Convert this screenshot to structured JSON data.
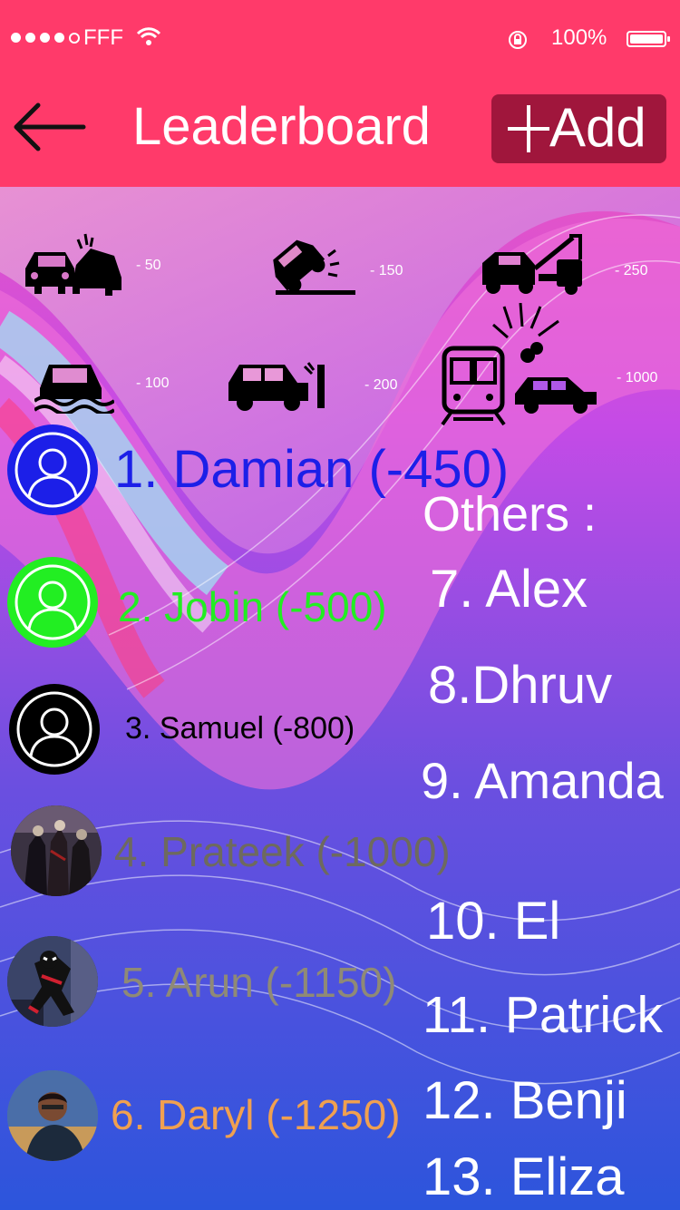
{
  "status_bar": {
    "carrier": "FFF",
    "battery": "100%"
  },
  "header": {
    "title": "Leaderboard",
    "add_label": "Add"
  },
  "penalties": [
    {
      "icon": "car-crash-icon",
      "points": "- 50"
    },
    {
      "icon": "car-flip-icon",
      "points": "- 150"
    },
    {
      "icon": "tow-truck-icon",
      "points": "- 250"
    },
    {
      "icon": "car-flood-icon",
      "points": "- 100"
    },
    {
      "icon": "car-hit-wall-icon",
      "points": "- 200"
    },
    {
      "icon": "train-car-collision-icon",
      "points": "- 1000"
    }
  ],
  "leaders": [
    {
      "text": "1. Damian (-450)",
      "color": "#1c1fe8"
    },
    {
      "text": "2. Jobin (-500)",
      "color": "#22ee22"
    },
    {
      "text": "3. Samuel (-800)",
      "color": "#000000"
    },
    {
      "text": "4. Prateek (-1000)",
      "color": "#6e6a5e"
    },
    {
      "text": "5. Arun (-1150)",
      "color": "#8f8a76"
    },
    {
      "text": "6. Daryl (-1250)",
      "color": "#f0a050"
    }
  ],
  "others": {
    "title": "Others :",
    "items": [
      "7. Alex",
      "8.Dhruv",
      "9. Amanda",
      "10. El",
      "11. Patrick",
      "12. Benji",
      "13. Eliza"
    ]
  }
}
